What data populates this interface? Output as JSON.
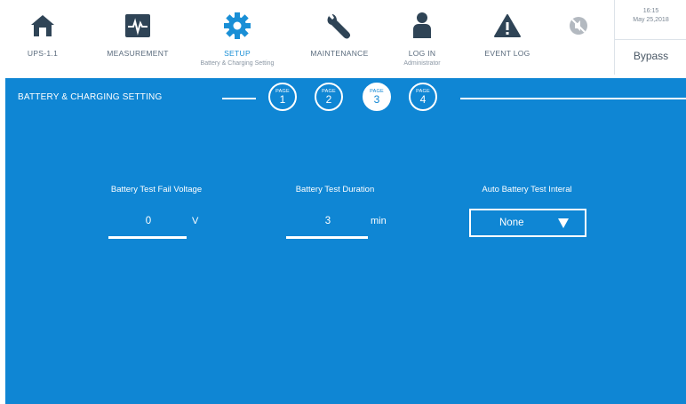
{
  "nav": {
    "ups_label": "UPS-1.1",
    "measurement_label": "MEASUREMENT",
    "setup_label": "SETUP",
    "setup_sub": "Battery & Charging Setting",
    "maintenance_label": "MAINTENANCE",
    "login_label": "LOG IN",
    "login_sub": "Administrator",
    "event_label": "EVENT LOG",
    "active_color": "#1a8fd6",
    "icons": [
      "home-icon",
      "pulse-icon",
      "gear-icon",
      "wrench-icon",
      "user-icon",
      "warning-icon",
      "mute-icon"
    ]
  },
  "status": {
    "time": "16:15",
    "date": "May 25,2018",
    "mode": "Bypass"
  },
  "panel": {
    "title": "BATTERY & CHARGING SETTING",
    "page_word": "PAGE",
    "pages": [
      "1",
      "2",
      "3",
      "4"
    ],
    "active_page": "3",
    "background": "#0f86d4"
  },
  "fields": {
    "fail_voltage": {
      "label": "Battery Test Fail Voltage",
      "value": "0",
      "unit": "V"
    },
    "duration": {
      "label": "Battery Test Duration",
      "value": "3",
      "unit": "min"
    },
    "interval": {
      "label": "Auto Battery Test Interal",
      "value": "None"
    }
  }
}
